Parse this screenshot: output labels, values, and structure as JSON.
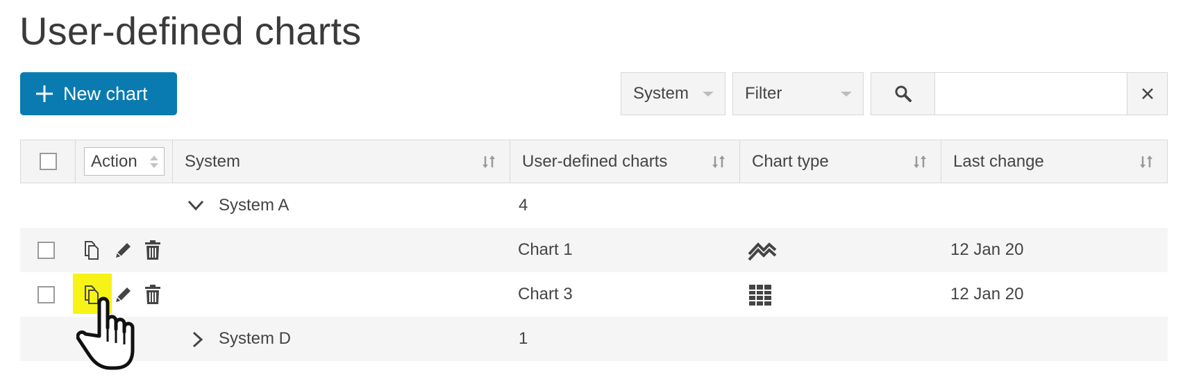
{
  "page": {
    "title": "User-defined charts"
  },
  "toolbar": {
    "new_button_label": "New chart",
    "system_filter": "System",
    "filter_label": "Filter",
    "search_value": "",
    "search_placeholder": ""
  },
  "table": {
    "action_header": "Action",
    "columns": [
      "System",
      "User-defined charts",
      "Chart type",
      "Last change"
    ],
    "groups": [
      {
        "name": "System A",
        "count": "4",
        "expanded": true
      },
      {
        "name": "System D",
        "count": "1",
        "expanded": false
      }
    ],
    "rows": [
      {
        "chart": "Chart 1",
        "chart_type_icon": "line-chart-icon",
        "last_change": "12 Jan 20"
      },
      {
        "chart": "Chart 3",
        "chart_type_icon": "table-chart-icon",
        "last_change": "12 Jan 20"
      }
    ]
  },
  "colors": {
    "primary": "#0a7bb0",
    "highlight": "#f7f317",
    "header_bg": "#f4f4f4",
    "row_shade": "#f5f5f5"
  }
}
